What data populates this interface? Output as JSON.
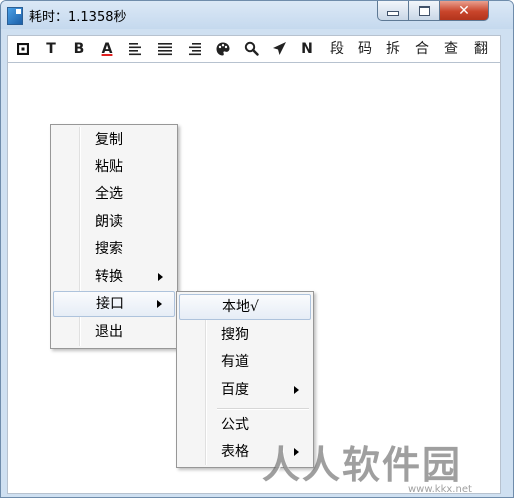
{
  "window": {
    "title": "耗时：1.1358秒",
    "controls": {
      "minimize": "minimize-icon",
      "maximize": "maximize-icon",
      "close": "close-icon"
    }
  },
  "toolbar": {
    "items": [
      {
        "id": "square",
        "icon": "square-icon",
        "label": ""
      },
      {
        "id": "T-plain",
        "label": "T"
      },
      {
        "id": "B-bold",
        "label": "B"
      },
      {
        "id": "A-color",
        "label": "A"
      },
      {
        "id": "align-left",
        "icon": "align-left-icon",
        "label": ""
      },
      {
        "id": "align-justify",
        "icon": "align-justify-icon",
        "label": ""
      },
      {
        "id": "align-right",
        "icon": "align-right-icon",
        "label": ""
      },
      {
        "id": "palette",
        "icon": "palette-icon",
        "label": ""
      },
      {
        "id": "search",
        "icon": "search-icon",
        "label": ""
      },
      {
        "id": "send",
        "icon": "send-icon",
        "label": ""
      },
      {
        "id": "N",
        "label": "N"
      },
      {
        "id": "duan",
        "label": "段"
      },
      {
        "id": "ma",
        "label": "码"
      },
      {
        "id": "chai",
        "label": "拆"
      },
      {
        "id": "he",
        "label": "合"
      },
      {
        "id": "cha",
        "label": "查"
      },
      {
        "id": "fan",
        "label": "翻"
      }
    ]
  },
  "context_menu": {
    "items": [
      {
        "label": "复制"
      },
      {
        "label": "粘贴"
      },
      {
        "label": "全选"
      },
      {
        "label": "朗读"
      },
      {
        "label": "搜索"
      },
      {
        "label": "转换",
        "submenu": true
      },
      {
        "label": "接口",
        "submenu": true,
        "highlighted": true
      },
      {
        "label": "退出"
      }
    ]
  },
  "submenu": {
    "items": [
      {
        "label": "本地√",
        "highlighted": true
      },
      {
        "label": "搜狗"
      },
      {
        "label": "有道"
      },
      {
        "label": "百度",
        "submenu": true
      },
      {
        "label": "公式"
      },
      {
        "label": "表格",
        "submenu": true
      }
    ]
  },
  "watermark": {
    "text": "人人软件园",
    "sub": "www.kkx.net"
  },
  "colors": {
    "accent_red": "#e02020",
    "highlight_border": "#aec3dc",
    "close_button": "#c9452b"
  }
}
